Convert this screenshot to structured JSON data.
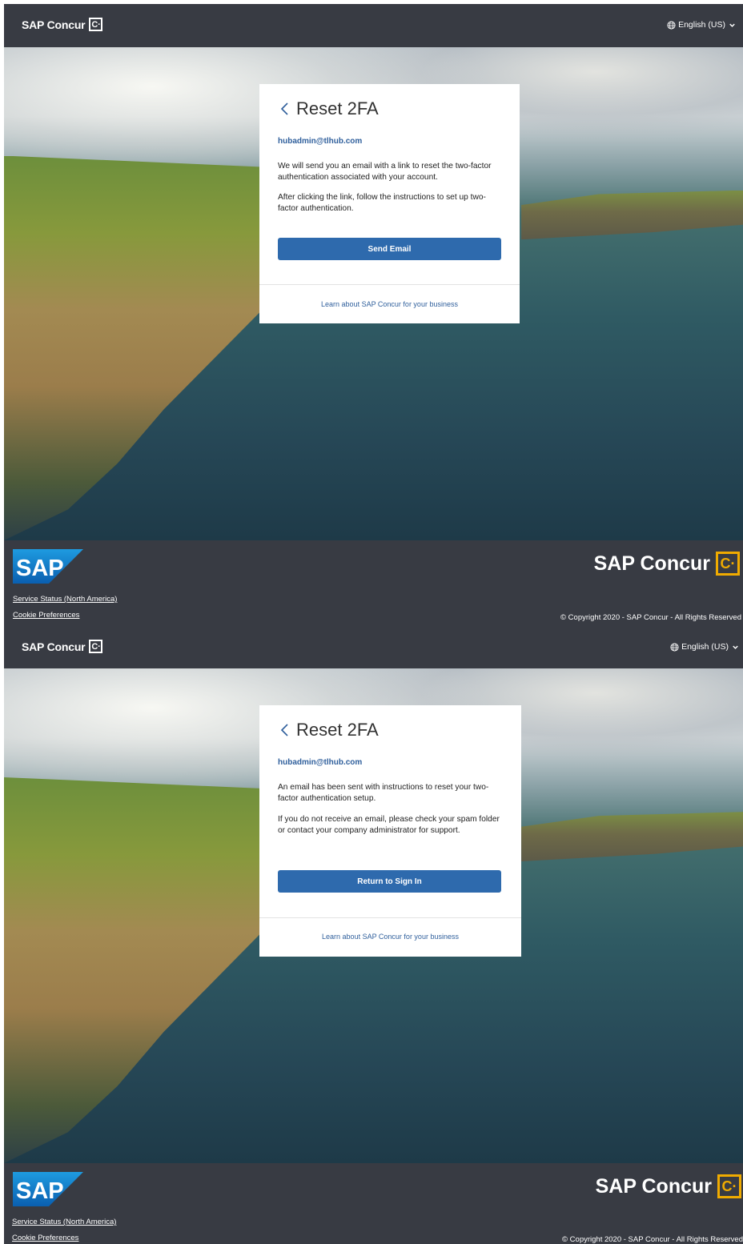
{
  "header": {
    "brand": "SAP Concur",
    "brand_mark": "C·",
    "language": "English (US)"
  },
  "screen1": {
    "title": "Reset 2FA",
    "email": "hubadmin@tlhub.com",
    "paragraph1": "We will send you an email with a link to reset the two-factor authentication associated with your account.",
    "paragraph2": "After clicking the link, follow the instructions to set up two-factor authentication.",
    "button": "Send Email",
    "learn_link": "Learn about SAP Concur for your business"
  },
  "screen2": {
    "title": "Reset 2FA",
    "email": "hubadmin@tlhub.com",
    "paragraph1": "An email has been sent with instructions to reset your two-factor authentication setup.",
    "paragraph2": "If you do not receive an email, please check your spam folder or contact your company administrator for support.",
    "button": "Return to Sign In",
    "learn_link": "Learn about SAP Concur for your business"
  },
  "footer": {
    "sap_logo_text": "SAP",
    "brand_big": "SAP Concur",
    "brand_big_mark": "C·",
    "service_status": "Service Status (North America)",
    "cookie_preferences": "Cookie Preferences",
    "copyright": "© Copyright 2020 - SAP Concur - All Rights Reserved"
  },
  "colors": {
    "bar": "#383b43",
    "primary_button": "#2e6aad",
    "link": "#2f5f9c",
    "concur_yellow": "#f0ab00"
  },
  "icons": [
    "chevron-left-icon",
    "globe-icon",
    "chevron-down-icon"
  ]
}
